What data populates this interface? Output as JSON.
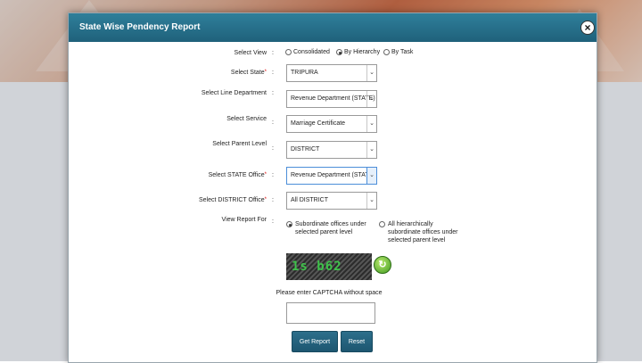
{
  "modal": {
    "title": "State Wise Pendency Report",
    "close_glyph": "×"
  },
  "form": {
    "select_view": {
      "label": "Select View",
      "options": [
        {
          "label": "Consolidated",
          "selected": false
        },
        {
          "label": "By Hierarchy",
          "selected": true
        },
        {
          "label": "By Task",
          "selected": false
        }
      ]
    },
    "state": {
      "label": "Select State",
      "required": true,
      "value": "TRIPURA"
    },
    "line_department": {
      "label": "Select Line Department",
      "required": false,
      "value": "Revenue Department (STATE)"
    },
    "service": {
      "label": "Select Service",
      "required": false,
      "value": "Marriage Certificate"
    },
    "parent_level": {
      "label": "Select Parent Level",
      "required": false,
      "value": "DISTRICT"
    },
    "state_office": {
      "label": "Select STATE Office",
      "required": true,
      "value": "Revenue Department (STATE)"
    },
    "district_office": {
      "label": "Select DISTRICT Office",
      "required": true,
      "value": "All DISTRICT"
    },
    "view_report_for": {
      "label": "View Report For",
      "options": [
        {
          "line1": "Subordinate offices under",
          "line2": "selected parent level",
          "line3": "",
          "selected": true
        },
        {
          "line1": "All hierarchically",
          "line2": "subordinate offices under",
          "line3": "selected parent level",
          "selected": false
        }
      ]
    }
  },
  "captcha": {
    "code": "1s b62",
    "refresh_glyph": "↻",
    "hint": "Please enter CAPTCHA without space",
    "input_value": ""
  },
  "buttons": {
    "get_report": "Get Report",
    "reset": "Reset"
  },
  "colors": {
    "header": "#2a7590",
    "button": "#2d6f8b",
    "required": "#dd0000",
    "captcha_text": "#3ec24a"
  }
}
